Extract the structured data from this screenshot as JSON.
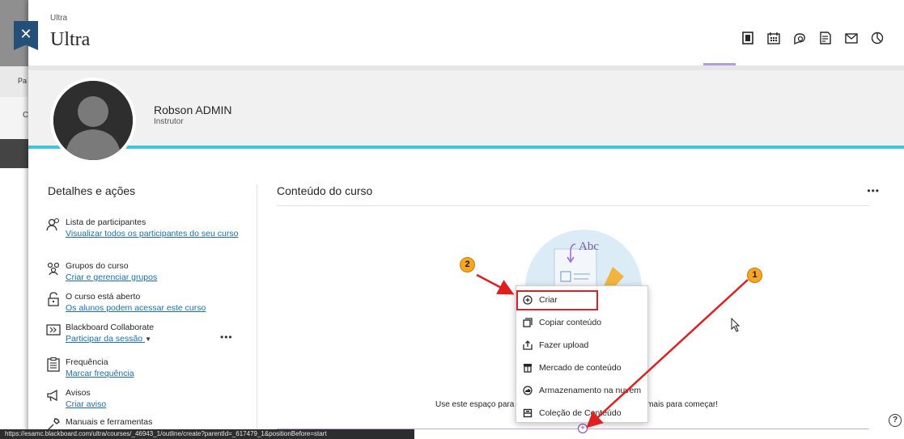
{
  "background": {
    "tab_fragment": "Pa",
    "row_fragment": "C"
  },
  "header": {
    "breadcrumb": "Ultra",
    "title": "Ultra",
    "nav_icons": [
      "outline-icon",
      "calendar-icon",
      "discussions-icon",
      "gradebook-icon",
      "messages-icon",
      "analytics-icon"
    ]
  },
  "profile": {
    "name": "Robson ADMIN",
    "role": "Instrutor"
  },
  "sidebar": {
    "title": "Detalhes e ações",
    "items": [
      {
        "label": "Lista de participantes",
        "link": "Visualizar todos os participantes do seu curso",
        "icon": "participants-icon"
      },
      {
        "label": "Grupos do curso",
        "link": "Criar e gerenciar grupos",
        "icon": "groups-icon"
      },
      {
        "label": "O curso está aberto",
        "link": "Os alunos podem acessar este curso",
        "icon": "unlock-icon"
      },
      {
        "label": "Blackboard Collaborate",
        "link": "Participar da sessão",
        "icon": "collaborate-icon"
      },
      {
        "label": "Frequência",
        "link": "Marcar frequência",
        "icon": "attendance-icon"
      },
      {
        "label": "Avisos",
        "link": "Criar aviso",
        "icon": "announcements-icon"
      },
      {
        "label": "Manuais e ferramentas",
        "link": "",
        "icon": "tools-icon"
      }
    ],
    "more": "•••"
  },
  "content": {
    "title": "Conteúdo do curso",
    "more": "•••",
    "illustration_label": "Abc",
    "empty_text_left": "Use este espaço para",
    "empty_text_right": "e mais para começar!",
    "add_symbol": "+",
    "help_symbol": "?"
  },
  "menu": {
    "items": [
      {
        "label": "Criar",
        "icon": "plus-circle-icon"
      },
      {
        "label": "Copiar conteúdo",
        "icon": "copy-icon"
      },
      {
        "label": "Fazer upload",
        "icon": "upload-icon"
      },
      {
        "label": "Mercado de conteúdo",
        "icon": "market-icon"
      },
      {
        "label": "Armazenamento na nuvem",
        "icon": "cloud-icon"
      },
      {
        "label": "Coleção de Conteúdo",
        "icon": "collection-icon"
      }
    ]
  },
  "status_bar": {
    "url": "https://esamc.blackboard.com/ultra/courses/_46943_1/outline/create?parentId=_617479_1&positionBefore=start"
  },
  "annotations": {
    "callout_1": "1",
    "callout_2": "2"
  },
  "colors": {
    "accent_teal": "#3ec6e0",
    "link": "#1a6fb3",
    "highlight": "#e02020",
    "purple": "#7b3fc4",
    "callout": "#f5a623"
  }
}
